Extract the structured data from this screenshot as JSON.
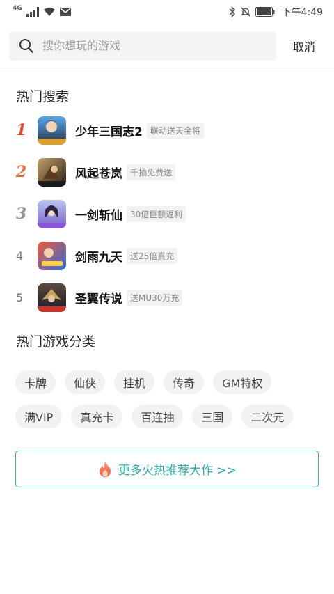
{
  "status_bar": {
    "network": "4G",
    "time": "下午4:49",
    "icons": [
      "signal-icon",
      "wifi-icon",
      "mail-icon",
      "bluetooth-icon",
      "mute-bell-icon",
      "battery-icon"
    ]
  },
  "search": {
    "placeholder": "搜你想玩的游戏",
    "cancel_label": "取消"
  },
  "hot_search": {
    "title": "热门搜索",
    "items": [
      {
        "rank": "1",
        "name": "少年三国志2",
        "tag": "联动送天金将"
      },
      {
        "rank": "2",
        "name": "风起苍岚",
        "tag": "千抽免费送"
      },
      {
        "rank": "3",
        "name": "一剑斩仙",
        "tag": "30倍巨额返利"
      },
      {
        "rank": "4",
        "name": "剑雨九天",
        "tag": "送25倍真充"
      },
      {
        "rank": "5",
        "name": "圣翼传说",
        "tag": "送MU30万充"
      }
    ]
  },
  "categories": {
    "title": "热门游戏分类",
    "row1": [
      "卡牌",
      "仙侠",
      "挂机",
      "传奇",
      "GM特权"
    ],
    "row2": [
      "满VIP",
      "真充卡",
      "百连抽",
      "三国",
      "二次元"
    ]
  },
  "more": {
    "label": "更多火热推荐大作 >>"
  },
  "colors": {
    "accent": "#2ea7a7",
    "rank1": "#e74a2c",
    "rank2": "#e26d3b",
    "rank3": "#a08c8c"
  }
}
